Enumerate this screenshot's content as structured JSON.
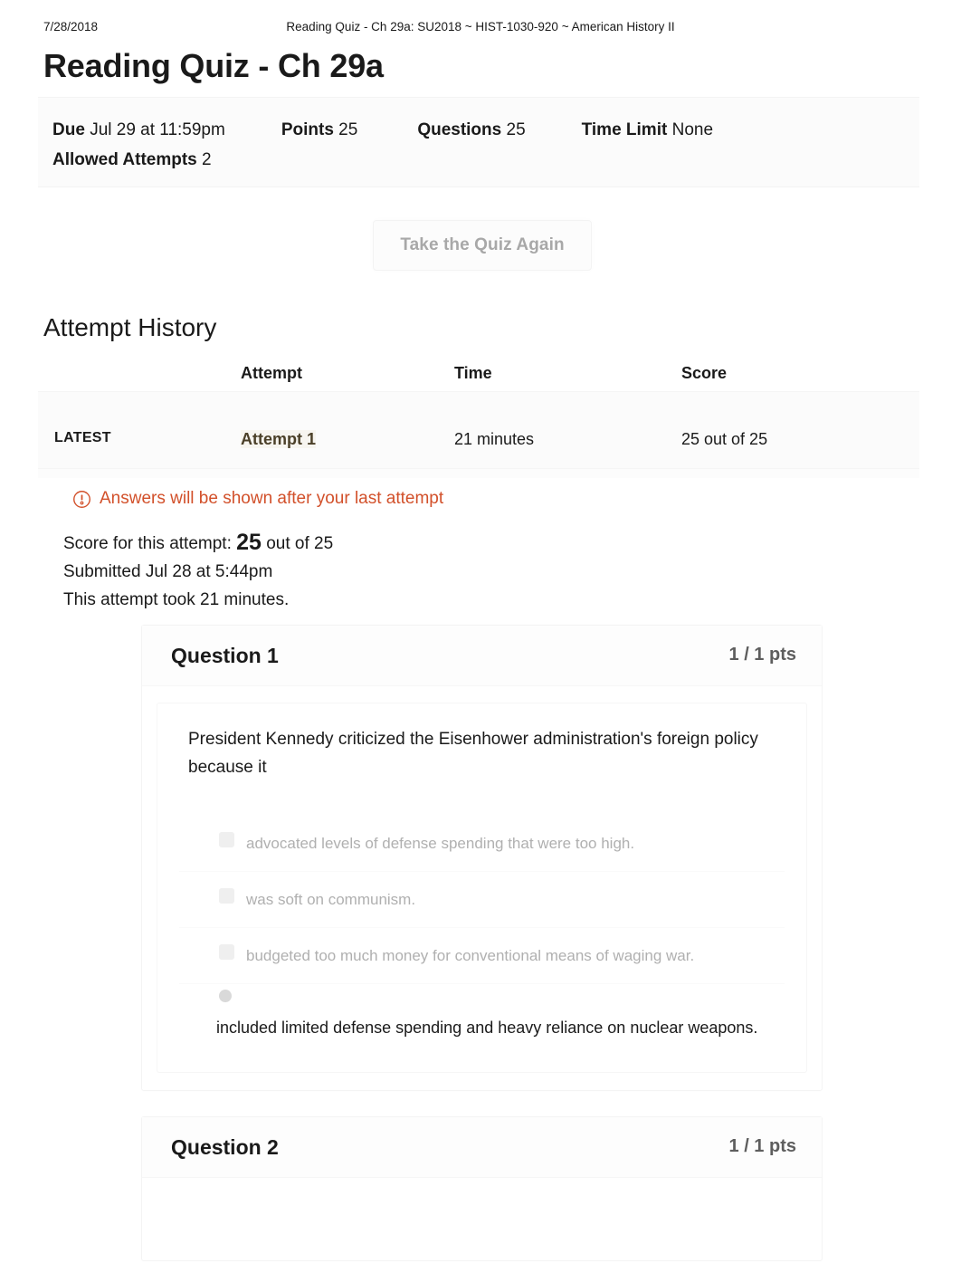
{
  "print_header": {
    "date": "7/28/2018",
    "title": "Reading Quiz - Ch 29a: SU2018 ~ HIST-1030-920 ~ American History II"
  },
  "page_title": "Reading Quiz - Ch 29a",
  "quiz_info": {
    "due_label": "Due",
    "due_value": "Jul 29 at 11:59pm",
    "points_label": "Points",
    "points_value": "25",
    "questions_label": "Questions",
    "questions_value": "25",
    "time_limit_label": "Time Limit",
    "time_limit_value": "None",
    "allowed_attempts_label": "Allowed Attempts",
    "allowed_attempts_value": "2"
  },
  "retake_button": {
    "label": "Take the Quiz Again"
  },
  "attempt_history": {
    "heading": "Attempt History",
    "columns": {
      "blank": "",
      "attempt": "Attempt",
      "time": "Time",
      "score": "Score"
    },
    "rows": [
      {
        "latest_badge": "LATEST",
        "attempt": "Attempt 1",
        "time": "21 minutes",
        "score": "25 out of 25"
      }
    ]
  },
  "answers_notice": {
    "icon": "warning-icon",
    "text": "Answers will be shown after your last attempt",
    "color": "#d2502a"
  },
  "score_summary": {
    "score_prefix": "Score for this attempt:",
    "score_value": "25",
    "score_suffix": "out of 25",
    "submitted": "Submitted Jul 28 at 5:44pm",
    "duration": "This attempt took 21 minutes."
  },
  "questions": [
    {
      "name": "Question 1",
      "points": "1 / 1 pts",
      "text": "President Kennedy criticized the Eisenhower administration's foreign policy because it",
      "answers": [
        {
          "text": "advocated levels of defense spending that were too high.",
          "selected": false
        },
        {
          "text": "was soft on communism.",
          "selected": false
        },
        {
          "text": "budgeted too much money for conventional means of waging war.",
          "selected": false
        },
        {
          "text": "included limited defense spending and heavy reliance on nuclear weapons.",
          "selected": true
        }
      ]
    },
    {
      "name": "Question 2",
      "points": "1 / 1 pts",
      "text": "",
      "answers": []
    }
  ],
  "colors": {
    "accent_orange": "#d2502a",
    "link_brown": "#4b4029",
    "text": "#1a1a1a",
    "muted": "#b0b0b0"
  }
}
